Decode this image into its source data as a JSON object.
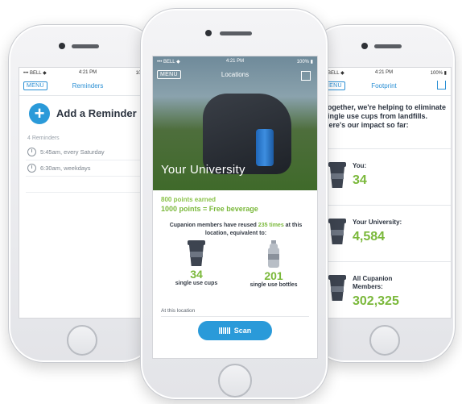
{
  "status_bar": {
    "carrier": "••• BELL ◆",
    "time": "4:21 PM",
    "battery": "100% ▮"
  },
  "left_phone": {
    "menu_label": "MENU",
    "title": "Reminders",
    "add_label": "Add a Reminder",
    "count_label": "4 Reminders",
    "reminders": [
      "5:45am, every Saturday",
      "6:30am, weekdays"
    ]
  },
  "center_phone": {
    "menu_label": "MENU",
    "title": "Locations",
    "location_name": "Your University",
    "points_earned": "800 points earned",
    "points_goal": "1000 points = Free beverage",
    "reuse_prefix": "Cupanion members have reused",
    "reuse_highlight": "235 times",
    "reuse_suffix": "at this location, equivalent to:",
    "stats": [
      {
        "value": "34",
        "label": "single use cups",
        "icon": "cup-icon"
      },
      {
        "value": "201",
        "label": "single use bottles",
        "icon": "bottle-icon"
      }
    ],
    "at_location_label": "At this location",
    "scan_label": "Scan"
  },
  "right_phone": {
    "menu_label": "MENU",
    "title": "Footprint",
    "intro": "Together, we're helping to eliminate single use cups from landfills. Here's our impact so far:",
    "rows": [
      {
        "label": "You:",
        "value": "34"
      },
      {
        "label": "Your University:",
        "value": "4,584"
      },
      {
        "label": "All Cupanion Members:",
        "value": "302,325"
      }
    ]
  },
  "colors": {
    "accent_blue": "#2a9ad9",
    "accent_green": "#7ab83a",
    "dark_text": "#2c3440"
  }
}
